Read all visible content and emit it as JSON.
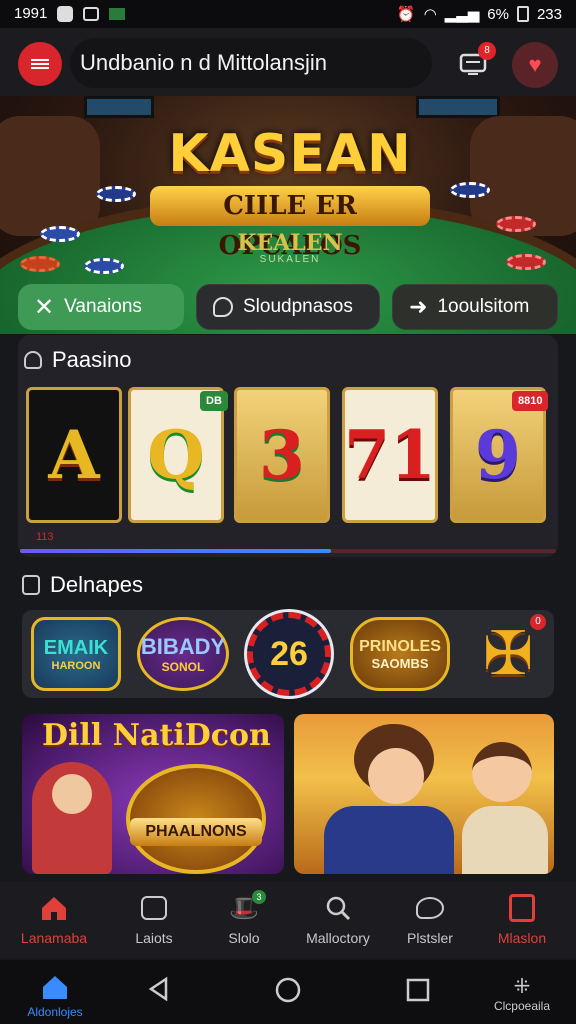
{
  "statusbar": {
    "time_left": "1991",
    "time_right": "233",
    "battery": "6%"
  },
  "appbar": {
    "title": "Undbanio n d Mittolansjin",
    "cart_badge": "8"
  },
  "hero": {
    "logo_main": "KASEAN",
    "logo_sub": "CIILE ER OPCALOS",
    "logo_table": "KEALEN",
    "logo_small": "SUKALEN"
  },
  "tabs": [
    {
      "label": "Vanaions",
      "icon": "close-icon"
    },
    {
      "label": "Sloudpnasos",
      "icon": "chat-icon"
    },
    {
      "label": "1ooulsitom",
      "icon": "arrow-icon"
    }
  ],
  "section1": {
    "title": "Paasino",
    "reels": [
      "A",
      "Q",
      "3",
      "71",
      "9"
    ],
    "tag_left": "DB",
    "tag_right": "8810",
    "footer_num": "113",
    "progress": 0.58
  },
  "section2": {
    "title": "Delnapes",
    "badges": [
      {
        "line1": "EMAIK",
        "line2": "HAROON"
      },
      {
        "line1": "BIBADY",
        "line2": "SONOL"
      },
      {
        "line1": "26",
        "line2": ""
      },
      {
        "line1": "PRINOLES",
        "line2": "SAOMBS"
      },
      {
        "line1": "✠",
        "line2": ""
      }
    ],
    "badge_dot": "0"
  },
  "cards": [
    {
      "title": "Dill NatiDcon",
      "sub": "PHAALNONS"
    },
    {
      "title": "",
      "sub": ""
    }
  ],
  "bottomnav": [
    {
      "label": "Lanamaba",
      "icon": "home-icon",
      "active": true
    },
    {
      "label": "Laiots",
      "icon": "robot-icon",
      "active": false
    },
    {
      "label": "Slolo",
      "icon": "hat-icon",
      "active": false
    },
    {
      "label": "Malloctory",
      "icon": "search-icon",
      "active": false
    },
    {
      "label": "Plstsler",
      "icon": "chat-bubble-icon",
      "active": false
    },
    {
      "label": "Mlaslon",
      "icon": "slot-machine-icon",
      "active": false
    }
  ],
  "slot_badge": "3",
  "sysnav": {
    "left_label": "Aldonlojes",
    "right_label": "Clcpoeaila"
  },
  "colors": {
    "accent": "#d8262c",
    "active_nav": "#e0403a",
    "tab_active": "#3f9a56"
  }
}
